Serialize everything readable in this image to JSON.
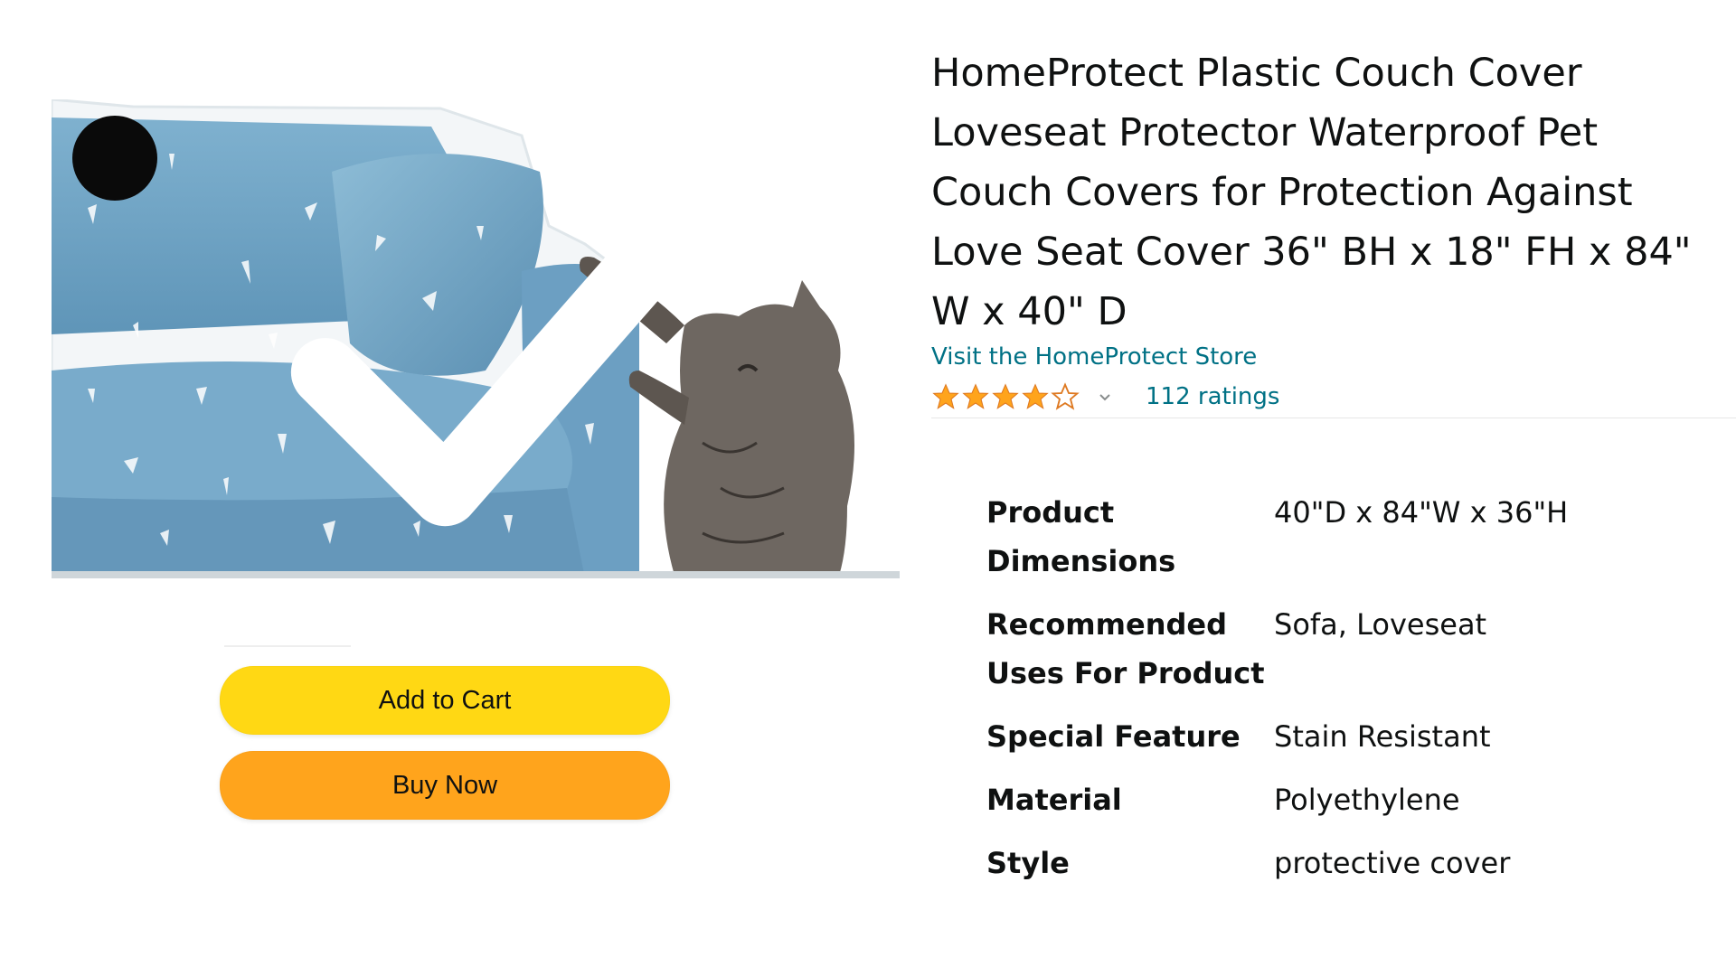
{
  "product": {
    "title": "HomeProtect Plastic Couch Cover Loveseat Protector Waterproof Pet Couch Covers for Protection Against Love Seat Cover 36\" BH x 18\" FH x 84\" W x 40\" D",
    "store_link": "Visit the HomeProtect Store",
    "rating_value": 4.3,
    "rating_max": 5,
    "ratings_count": "112 ratings",
    "star_color": "#ffa41c",
    "link_color": "#007185"
  },
  "image": {
    "selected_badge_icon": "checkmark-icon",
    "description_icon": "couch-cover-with-cat"
  },
  "buttons": {
    "add_to_cart": "Add to Cart",
    "buy_now": "Buy Now",
    "add_to_cart_color": "#ffd814",
    "buy_now_color": "#ffa41c"
  },
  "specs": [
    {
      "label": "Product Dimensions",
      "value": "40\"D x 84\"W x 36\"H"
    },
    {
      "label": "Recommended Uses For Product",
      "value": "Sofa, Loveseat"
    },
    {
      "label": "Special Feature",
      "value": "Stain Resistant"
    },
    {
      "label": "Material",
      "value": "Polyethylene"
    },
    {
      "label": "Style",
      "value": "protective cover"
    }
  ]
}
